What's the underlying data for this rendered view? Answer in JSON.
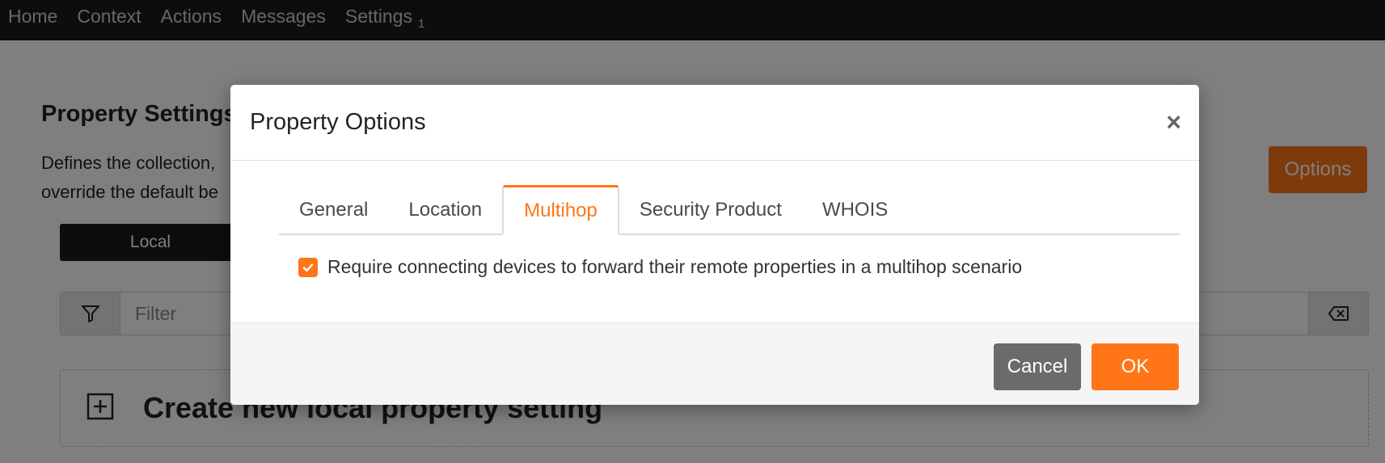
{
  "nav": {
    "items": [
      {
        "label": "Home"
      },
      {
        "label": "Context"
      },
      {
        "label": "Actions"
      },
      {
        "label": "Messages"
      },
      {
        "label": "Settings",
        "badge": "1"
      }
    ]
  },
  "background": {
    "title": "Property Settings",
    "description_line1": "Defines the collection,",
    "description_line2": "override the default be",
    "options_button": "Options",
    "local_button": "Local",
    "filter_placeholder": "Filter",
    "create_label": "Create new local property setting"
  },
  "modal": {
    "title": "Property Options",
    "close_symbol": "×",
    "tabs": [
      {
        "label": "General",
        "active": false
      },
      {
        "label": "Location",
        "active": false
      },
      {
        "label": "Multihop",
        "active": true
      },
      {
        "label": "Security Product",
        "active": false
      },
      {
        "label": "WHOIS",
        "active": false
      }
    ],
    "checkbox": {
      "checked": true,
      "label": "Require connecting devices to forward their remote properties in a multihop scenario"
    },
    "cancel_label": "Cancel",
    "ok_label": "OK"
  },
  "colors": {
    "accent": "#ff7518",
    "nav_bg": "#1b1b1b",
    "cancel_bg": "#6b6b6b"
  }
}
